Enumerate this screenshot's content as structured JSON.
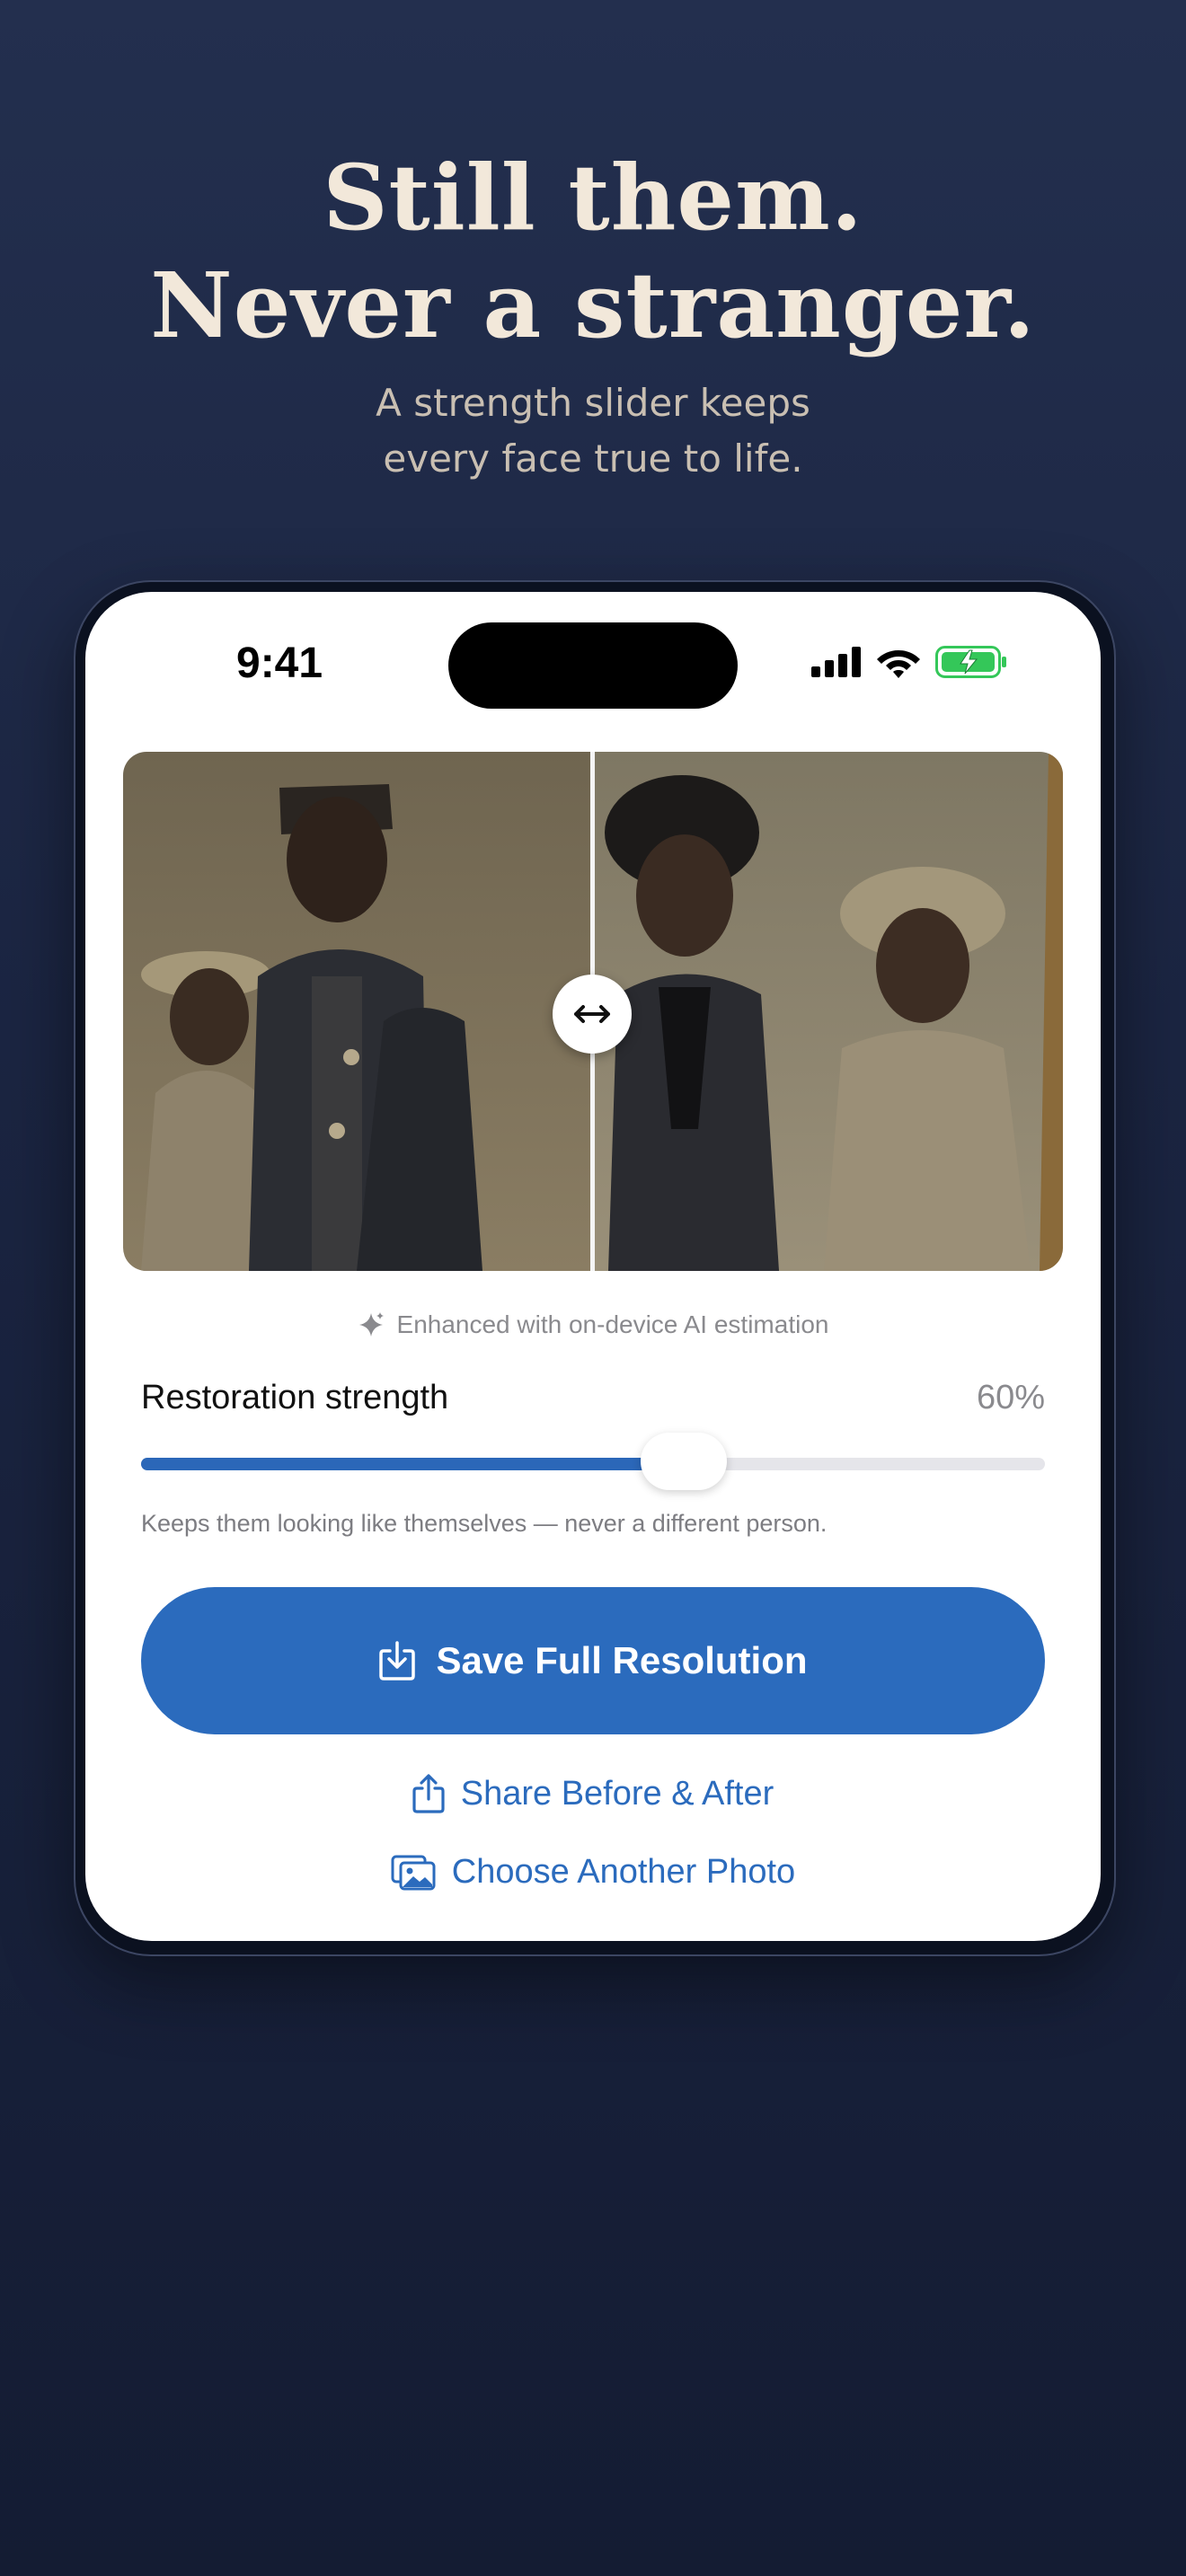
{
  "marketing": {
    "headline_line1": "Still them.",
    "headline_line2": "Never a stranger.",
    "subhead_line1": "A strength slider keeps",
    "subhead_line2": "every face true to life."
  },
  "status_bar": {
    "time": "9:41",
    "icons": [
      "cellular-signal-icon",
      "wifi-icon",
      "battery-charging-icon"
    ]
  },
  "comparison": {
    "ai_note": "Enhanced with on-device AI estimation",
    "divider_position": 0.5
  },
  "strength": {
    "label": "Restoration strength",
    "value_text": "60%",
    "value": 0.6,
    "hint": "Keeps them looking like themselves — never a different person."
  },
  "actions": {
    "save_label": "Save Full Resolution",
    "share_label": "Share Before & After",
    "choose_label": "Choose Another Photo"
  },
  "colors": {
    "accent": "#2b6bbd",
    "background_top": "#232f4e",
    "background_bottom": "#141c33",
    "headline": "#f2e8da"
  }
}
